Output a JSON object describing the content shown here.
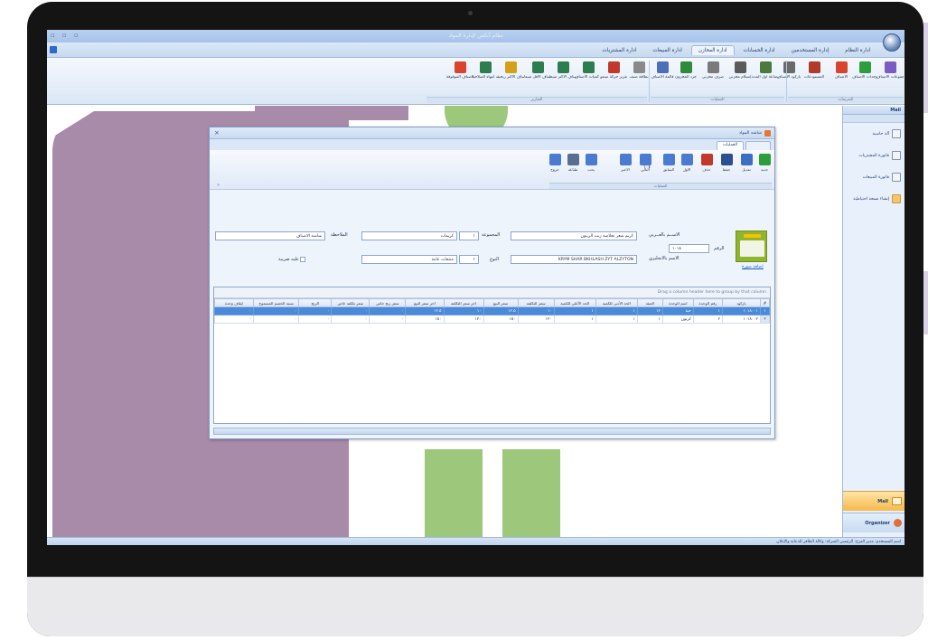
{
  "window": {
    "title": "نظام أبكس لإدارة المواد"
  },
  "menu": {
    "tabs": [
      {
        "label": "ادارة النظام"
      },
      {
        "label": "إدارة المستخدمين"
      },
      {
        "label": "ادارة الحسابات"
      },
      {
        "label": "ادارة المخازن"
      },
      {
        "label": "ادارة المبيعات"
      },
      {
        "label": "ادارة المشتريات"
      }
    ]
  },
  "ribbon": {
    "buttons": [
      {
        "label": "مجموعات الاصناف",
        "icon": "groups-icon",
        "color": "#7b5cc4"
      },
      {
        "label": "وحدات الاصناف",
        "icon": "units-icon",
        "color": "#2e9d3c"
      },
      {
        "label": "الاصناف",
        "icon": "items-icon",
        "color": "#d8452c"
      },
      {
        "label": "المستودعات",
        "icon": "warehouse-icon",
        "color": "#b23a2a"
      },
      {
        "label": "باركود الاصناف",
        "icon": "barcode-icon",
        "color": "#6a6a6a"
      },
      {
        "label": "بضاعة اول المدة",
        "icon": "opening-stock-icon",
        "color": "#4c7a3a"
      },
      {
        "label": "إستلام مخزني",
        "icon": "receive-icon",
        "color": "#5a5a5a"
      },
      {
        "label": "صرف مخزني",
        "icon": "issue-icon",
        "color": "#7a7a7a"
      },
      {
        "label": "جرد المخزون",
        "icon": "inventory-icon",
        "color": "#2f8a3b"
      },
      {
        "label": "قائمة الاصناف",
        "icon": "list-icon",
        "color": "#4b6fb8"
      },
      {
        "label": "بطاقة صنف",
        "icon": "card-icon",
        "color": "#8a8a8a"
      },
      {
        "label": "تقرير حركة صنف",
        "icon": "movement-report-icon",
        "color": "#c0392b"
      },
      {
        "label": "تقرير كميات الاصناف",
        "icon": "qty-report-icon",
        "color": "#2e7d4f"
      },
      {
        "label": "الاصناف الأكثر مبيعا",
        "icon": "bestsellers-icon",
        "color": "#2e7d4f"
      },
      {
        "label": "الاصناف الأقل مبيعا",
        "icon": "leastsellers-icon",
        "color": "#2e7d4f"
      },
      {
        "label": "الاصناف الأكثر ربحية",
        "icon": "profit-icon",
        "color": "#d4a017"
      },
      {
        "label": "اصناف قرب انتهاء الصلاحية",
        "icon": "expiry-icon",
        "color": "#2e7d4f"
      },
      {
        "label": "الاصناف الموقوفة",
        "icon": "stopped-icon",
        "color": "#d8452c"
      }
    ],
    "groups": [
      {
        "label": "التعريفات"
      },
      {
        "label": "العمليات"
      },
      {
        "label": "التقارير"
      }
    ]
  },
  "card": {
    "title": "شاشة المواد",
    "tab_active": "العمليات",
    "toolbar": {
      "buttons": [
        {
          "label": "جديد",
          "icon": "new-icon",
          "color": "#2e9d3c"
        },
        {
          "label": "تعديل",
          "icon": "edit-icon",
          "color": "#3b6fc4"
        },
        {
          "label": "حفظ",
          "icon": "save-icon",
          "color": "#2c4f8f"
        },
        {
          "label": "حذف",
          "icon": "delete-icon",
          "color": "#c0392b"
        },
        {
          "label": "الاول",
          "icon": "first-icon",
          "color": "#4a7bd0"
        },
        {
          "label": "السابق",
          "icon": "prev-icon",
          "color": "#4a7bd0"
        },
        {
          "label": "التالي",
          "icon": "next-icon",
          "color": "#4a7bd0"
        },
        {
          "label": "الاخير",
          "icon": "last-icon",
          "color": "#4a7bd0"
        },
        {
          "label": "بحث",
          "icon": "search-icon",
          "color": "#4a7bd0"
        },
        {
          "label": "طباعة",
          "icon": "print-icon",
          "color": "#5a6e8f"
        },
        {
          "label": "خروج",
          "icon": "exit-icon",
          "color": "#4a7bd0"
        }
      ],
      "group_label": "العمليات",
      "record_number": "١٠٤"
    },
    "form": {
      "name_ar_label": "الاســم بالعــربي",
      "name_ar_value": "كريم شعر بخلاصة زيت الزيتون",
      "name_en_label": "الاسم بالانجليزي",
      "name_en_value": "KRYM SHAR BKHLASH ZYT ALZYTON",
      "number_label": "الرقم",
      "number_value": "١٠١٨",
      "group_label": "المجموعة",
      "group_code": "١",
      "group_name": "كريمات",
      "type_label": "النوع",
      "type_code": "١",
      "type_name": "منتجات عامة",
      "note_label": "الملاحظة",
      "note_value": "شاشة الاصناف",
      "tax_label": "عليه ضريبة",
      "add_photo": "إضافة صورة"
    },
    "grid": {
      "group_hint": "Drag a column header here to group by that column",
      "columns": [
        "#",
        "باركود",
        "رقم الوحدة",
        "اسم الوحدة",
        "العبئة",
        "الحد الأدنى للكمية",
        "الحد الأعلى للكمية",
        "سعر التكلفة",
        "سعر البيع",
        "اخر سعر التكلفة",
        "اخر سعر البيع",
        "سعر ربح خاص",
        "سعر تكلفة خاص",
        "الربح",
        "نسبة الخصم المسموح",
        "ايقاف وحدة"
      ],
      "rows": [
        {
          "n": "١",
          "barcode": "١٠١٨٠٠١",
          "unit_no": "١",
          "unit_name": "حبة",
          "pack": "١٢",
          "min": "١",
          "max": "١",
          "cost": "١٠",
          "price": "١٢.٥",
          "last_cost": "١٠",
          "last_price": "١٢.٥",
          "special_profit": "٠",
          "special_cost": "٠",
          "profit": "٠",
          "discount": "٠",
          "stop": "٠"
        },
        {
          "n": "٢",
          "barcode": "١٠١٨٠٠٢",
          "unit_no": "٢",
          "unit_name": "كرتون",
          "pack": "١",
          "min": "١",
          "max": "١",
          "cost": "١٢٠",
          "price": "١٥٠",
          "last_cost": "١٢٠",
          "last_price": "١٥٠",
          "special_profit": "٠",
          "special_cost": "٠",
          "profit": "٠",
          "discount": "٠",
          "stop": "٠"
        }
      ]
    }
  },
  "mailpane": {
    "header": "Mail",
    "items": [
      {
        "label": "آلة حاسبة"
      },
      {
        "label": "فاتورة المشتريات"
      },
      {
        "label": "فاتورة المبيعات"
      },
      {
        "label": "إنشاء نسخة احتياطية"
      }
    ],
    "nav_mail": "Mail",
    "nav_organizer": "Organizer"
  },
  "status": {
    "text": "اسم المستخدم: مدير  الفرع: الرئيسي  الشركة: وكالة الظافر للدعاية والإعلان"
  }
}
